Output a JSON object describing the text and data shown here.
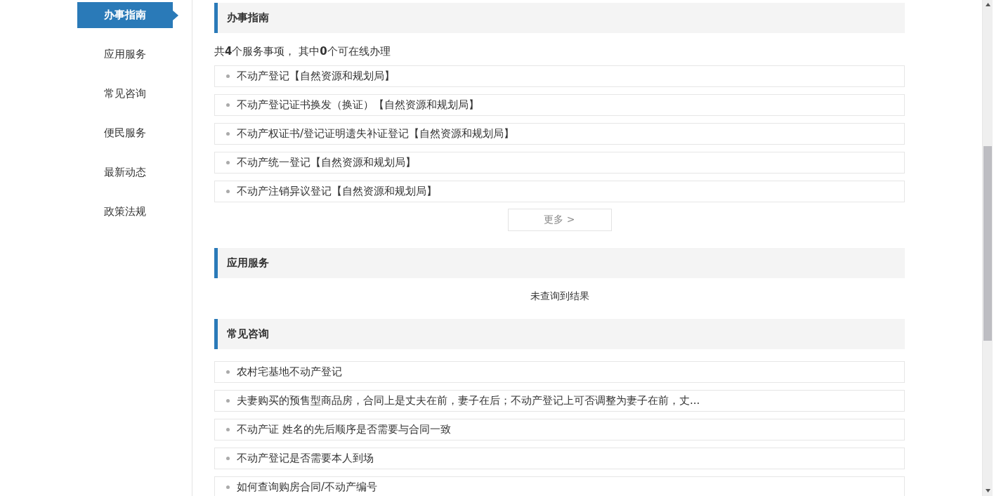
{
  "sidebar": {
    "items": [
      {
        "label": "办事指南",
        "selected": true
      },
      {
        "label": "应用服务",
        "selected": false
      },
      {
        "label": "常见咨询",
        "selected": false
      },
      {
        "label": "便民服务",
        "selected": false
      },
      {
        "label": "最新动态",
        "selected": false
      },
      {
        "label": "政策法规",
        "selected": false
      }
    ]
  },
  "sections": [
    {
      "title": "办事指南",
      "summary": "共**4**个服务事项， 其中**0**个可在线办理",
      "items": [
        "不动产登记【自然资源和规划局】",
        "不动产登记证书换发（换证）【自然资源和规划局】",
        "不动产权证书/登记证明遗失补证登记【自然资源和规划局】",
        "不动产统一登记【自然资源和规划局】",
        "不动产注销异议登记【自然资源和规划局】"
      ],
      "more_button": "更多 >"
    },
    {
      "title": "应用服务",
      "empty_text": "未查询到结果"
    },
    {
      "title": "常见咨询",
      "items": [
        "农村宅基地不动产登记",
        "夫妻购买的预售型商品房，合同上是丈夫在前，妻子在后；不动产登记上可否调整为妻子在前，丈...",
        "不动产证 姓名的先后顺序是否需要与合同一致",
        "不动产登记是否需要本人到场",
        "如何查询购房合同/不动产编号"
      ]
    }
  ]
}
